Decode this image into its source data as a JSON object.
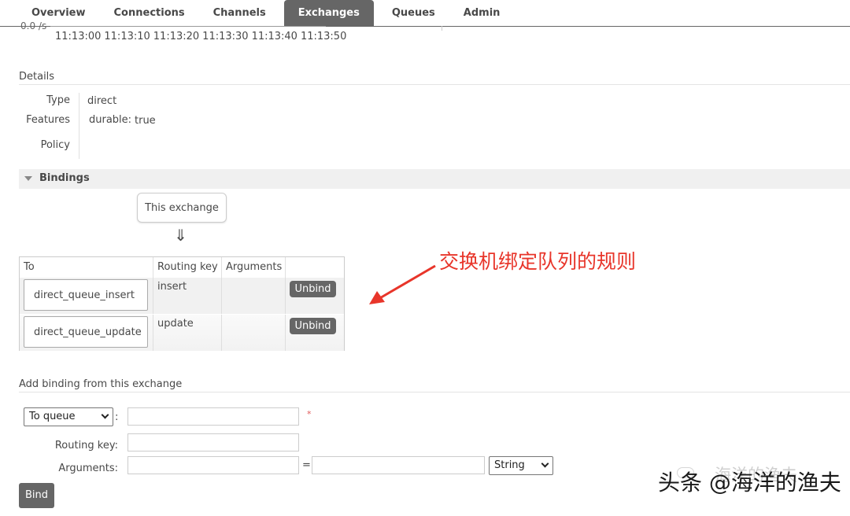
{
  "nav": {
    "tabs": [
      {
        "label": "Overview",
        "active": false
      },
      {
        "label": "Connections",
        "active": false
      },
      {
        "label": "Channels",
        "active": false
      },
      {
        "label": "Exchanges",
        "active": true
      },
      {
        "label": "Queues",
        "active": false
      },
      {
        "label": "Admin",
        "active": false
      }
    ]
  },
  "chart": {
    "y_label": "0.0 /s",
    "x_ticks": [
      "11:13:00",
      "11:13:10",
      "11:13:20",
      "11:13:30",
      "11:13:40",
      "11:13:50"
    ]
  },
  "details": {
    "title": "Details",
    "type_label": "Type",
    "type_value": "direct",
    "features_label": "Features",
    "features_key": "durable:",
    "features_value": "true",
    "policy_label": "Policy"
  },
  "bindings": {
    "title": "Bindings",
    "source_label": "This exchange",
    "arrow": "⇓",
    "columns": [
      "To",
      "Routing key",
      "Arguments"
    ],
    "rows": [
      {
        "to": "direct_queue_insert",
        "routing_key": "insert",
        "arguments": "",
        "action": "Unbind"
      },
      {
        "to": "direct_queue_update",
        "routing_key": "update",
        "arguments": "",
        "action": "Unbind"
      }
    ]
  },
  "add_binding": {
    "title": "Add binding from this exchange",
    "destination_select": "To queue",
    "destination_colon": ":",
    "required_mark": "*",
    "routing_key_label": "Routing key:",
    "arguments_label": "Arguments:",
    "equals": "=",
    "arg_type_select": "String",
    "bind_label": "Bind"
  },
  "annotation": {
    "text": "交换机绑定队列的规则",
    "color": "#e8352a"
  },
  "watermark": {
    "text": "头条 @海洋的渔夫",
    "faint_text": "海洋的渔夫"
  },
  "colors": {
    "nav_active_bg": "#666666",
    "button_bg": "#666666",
    "text": "#484848"
  }
}
